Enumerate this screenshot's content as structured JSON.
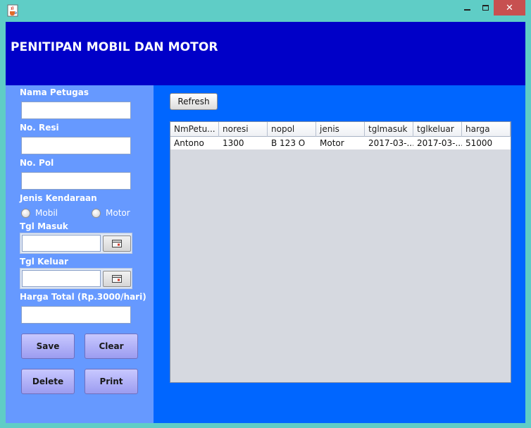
{
  "window": {
    "close_glyph": "✕"
  },
  "header": {
    "title": "PENITIPAN MOBIL DAN MOTOR"
  },
  "form": {
    "nama_petugas_label": "Nama Petugas",
    "nama_petugas_value": "",
    "no_resi_label": "No. Resi",
    "no_resi_value": "",
    "no_pol_label": "No. Pol",
    "no_pol_value": "",
    "jenis_label": "Jenis Kendaraan",
    "jenis_options": [
      "Mobil",
      "Motor"
    ],
    "tgl_masuk_label": "Tgl Masuk",
    "tgl_masuk_value": "",
    "tgl_keluar_label": "Tgl Keluar",
    "tgl_keluar_value": "",
    "harga_label": "Harga Total (Rp.3000/hari)",
    "harga_value": ""
  },
  "buttons": {
    "save": "Save",
    "clear": "Clear",
    "delete": "Delete",
    "print": "Print",
    "refresh": "Refresh"
  },
  "table": {
    "columns": [
      "NmPetu...",
      "noresi",
      "nopol",
      "jenis",
      "tglmasuk",
      "tglkeluar",
      "harga"
    ],
    "rows": [
      [
        "Antono",
        "1300",
        "B 123 O",
        "Motor",
        "2017-03-...",
        "2017-03-...",
        "51000"
      ]
    ]
  },
  "colors": {
    "header_bg": "#0000c8",
    "left_panel_bg": "#6699ff",
    "right_panel_bg": "#0066ff",
    "window_frame": "#5fcdc6",
    "close_button": "#c75050"
  },
  "icons": {
    "app_icon": "java-cup-icon",
    "calendar": "calendar-icon"
  }
}
